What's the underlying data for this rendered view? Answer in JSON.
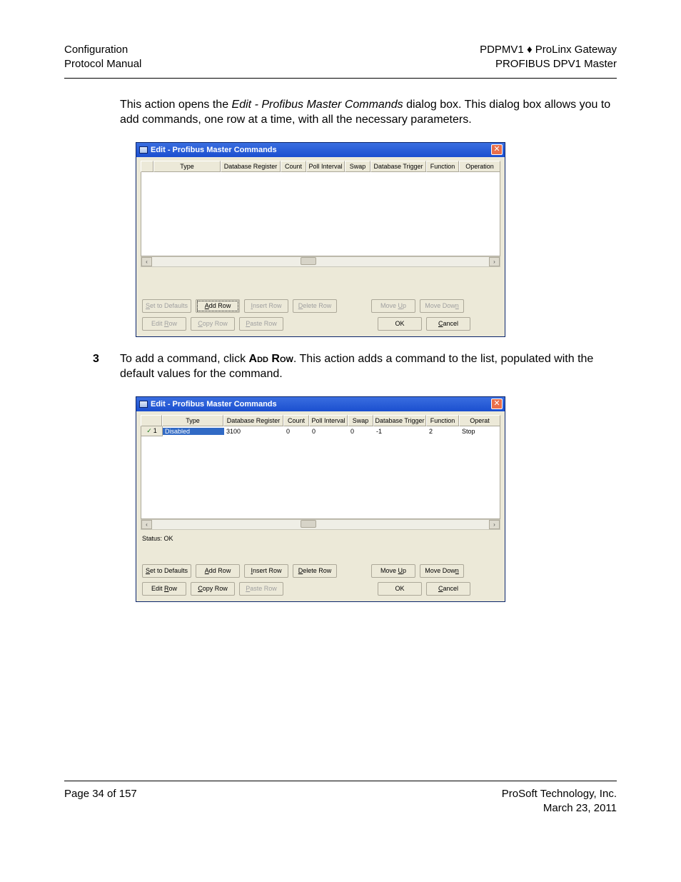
{
  "header": {
    "left1": "Configuration",
    "left2": "Protocol Manual",
    "right1": "PDPMV1 ♦ ProLinx Gateway",
    "right2": "PROFIBUS DPV1 Master"
  },
  "para1_a": "This action opens the ",
  "para1_b": "Edit - Profibus Master Commands",
  "para1_c": " dialog box. This dialog box allows you to add commands, one row at a time, with all the necessary parameters.",
  "dialog1": {
    "title": "Edit - Profibus Master Commands",
    "close": "✕",
    "cols": {
      "type": "Type",
      "dbreg": "Database Register",
      "count": "Count",
      "poll": "Poll Interval",
      "swap": "Swap",
      "dbtrig": "Database Trigger",
      "func": "Function",
      "oper": "Operation"
    },
    "buttons": {
      "setdef": "Set to Defaults",
      "addrow": "Add Row",
      "insrow": "Insert Row",
      "delrow": "Delete Row",
      "moveup": "Move Up",
      "movedn": "Move Down",
      "editrow": "Edit Row",
      "copyrow": "Copy Row",
      "pasterow": "Paste Row",
      "ok": "OK",
      "cancel": "Cancel"
    }
  },
  "step3_num": "3",
  "step3_a": "To add a command, click ",
  "step3_b": "Add Row",
  "step3_c": ". This action adds a command to the list, populated with the default values for the command.",
  "dialog2": {
    "title": "Edit - Profibus Master Commands",
    "close": "✕",
    "cols": {
      "type": "Type",
      "dbreg": "Database Register",
      "count": "Count",
      "poll": "Poll Interval",
      "swap": "Swap",
      "dbtrig": "Database Trigger",
      "func": "Function",
      "oper": "Operat"
    },
    "row1": {
      "num": "1",
      "type": "Disabled",
      "dbreg": "3100",
      "count": "0",
      "poll": "0",
      "swap": "0",
      "dbtrig": "-1",
      "func": "2",
      "oper": "Stop"
    },
    "status": "Status: OK",
    "buttons": {
      "setdef": "Set to Defaults",
      "addrow": "Add Row",
      "insrow": "Insert Row",
      "delrow": "Delete Row",
      "moveup": "Move Up",
      "movedn": "Move Down",
      "editrow": "Edit Row",
      "copyrow": "Copy Row",
      "pasterow": "Paste Row",
      "ok": "OK",
      "cancel": "Cancel"
    }
  },
  "footer": {
    "left": "Page 34 of 157",
    "right1": "ProSoft Technology, Inc.",
    "right2": "March 23, 2011"
  }
}
